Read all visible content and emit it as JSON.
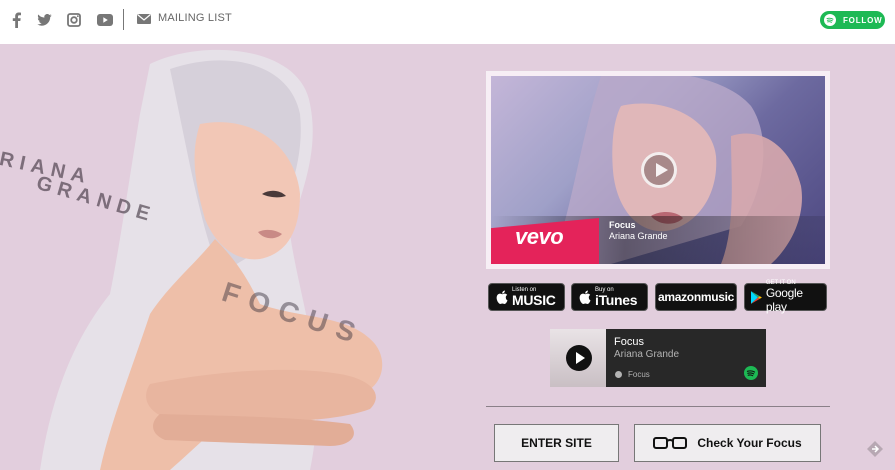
{
  "topbar": {
    "social_icons": [
      "facebook-icon",
      "twitter-icon",
      "instagram-icon",
      "youtube-icon"
    ],
    "mailing_list_label": "MAILING LIST",
    "follow_label": "FOLLOW"
  },
  "hero": {
    "ghost_line1": "RIANA",
    "ghost_line2": "GRANDE",
    "ghost_focus": "FOCUS"
  },
  "video": {
    "logo": "vevo",
    "title": "Focus",
    "artist": "Ariana Grande"
  },
  "stores": [
    {
      "small": "Listen on",
      "big": "MUSIC"
    },
    {
      "small": "Buy on",
      "big": "iTunes"
    },
    {
      "small": "",
      "big": "amazonmusic"
    },
    {
      "small": "GET IT ON",
      "big": "Google play"
    }
  ],
  "spotify": {
    "title": "Focus",
    "artist": "Ariana Grande",
    "album": "Focus"
  },
  "buttons": {
    "enter_site": "ENTER SITE",
    "check_focus": "Check Your Focus"
  },
  "colors": {
    "background": "#e2cedd",
    "spotify_green": "#1db954",
    "vevo_pink": "#e4235a"
  }
}
